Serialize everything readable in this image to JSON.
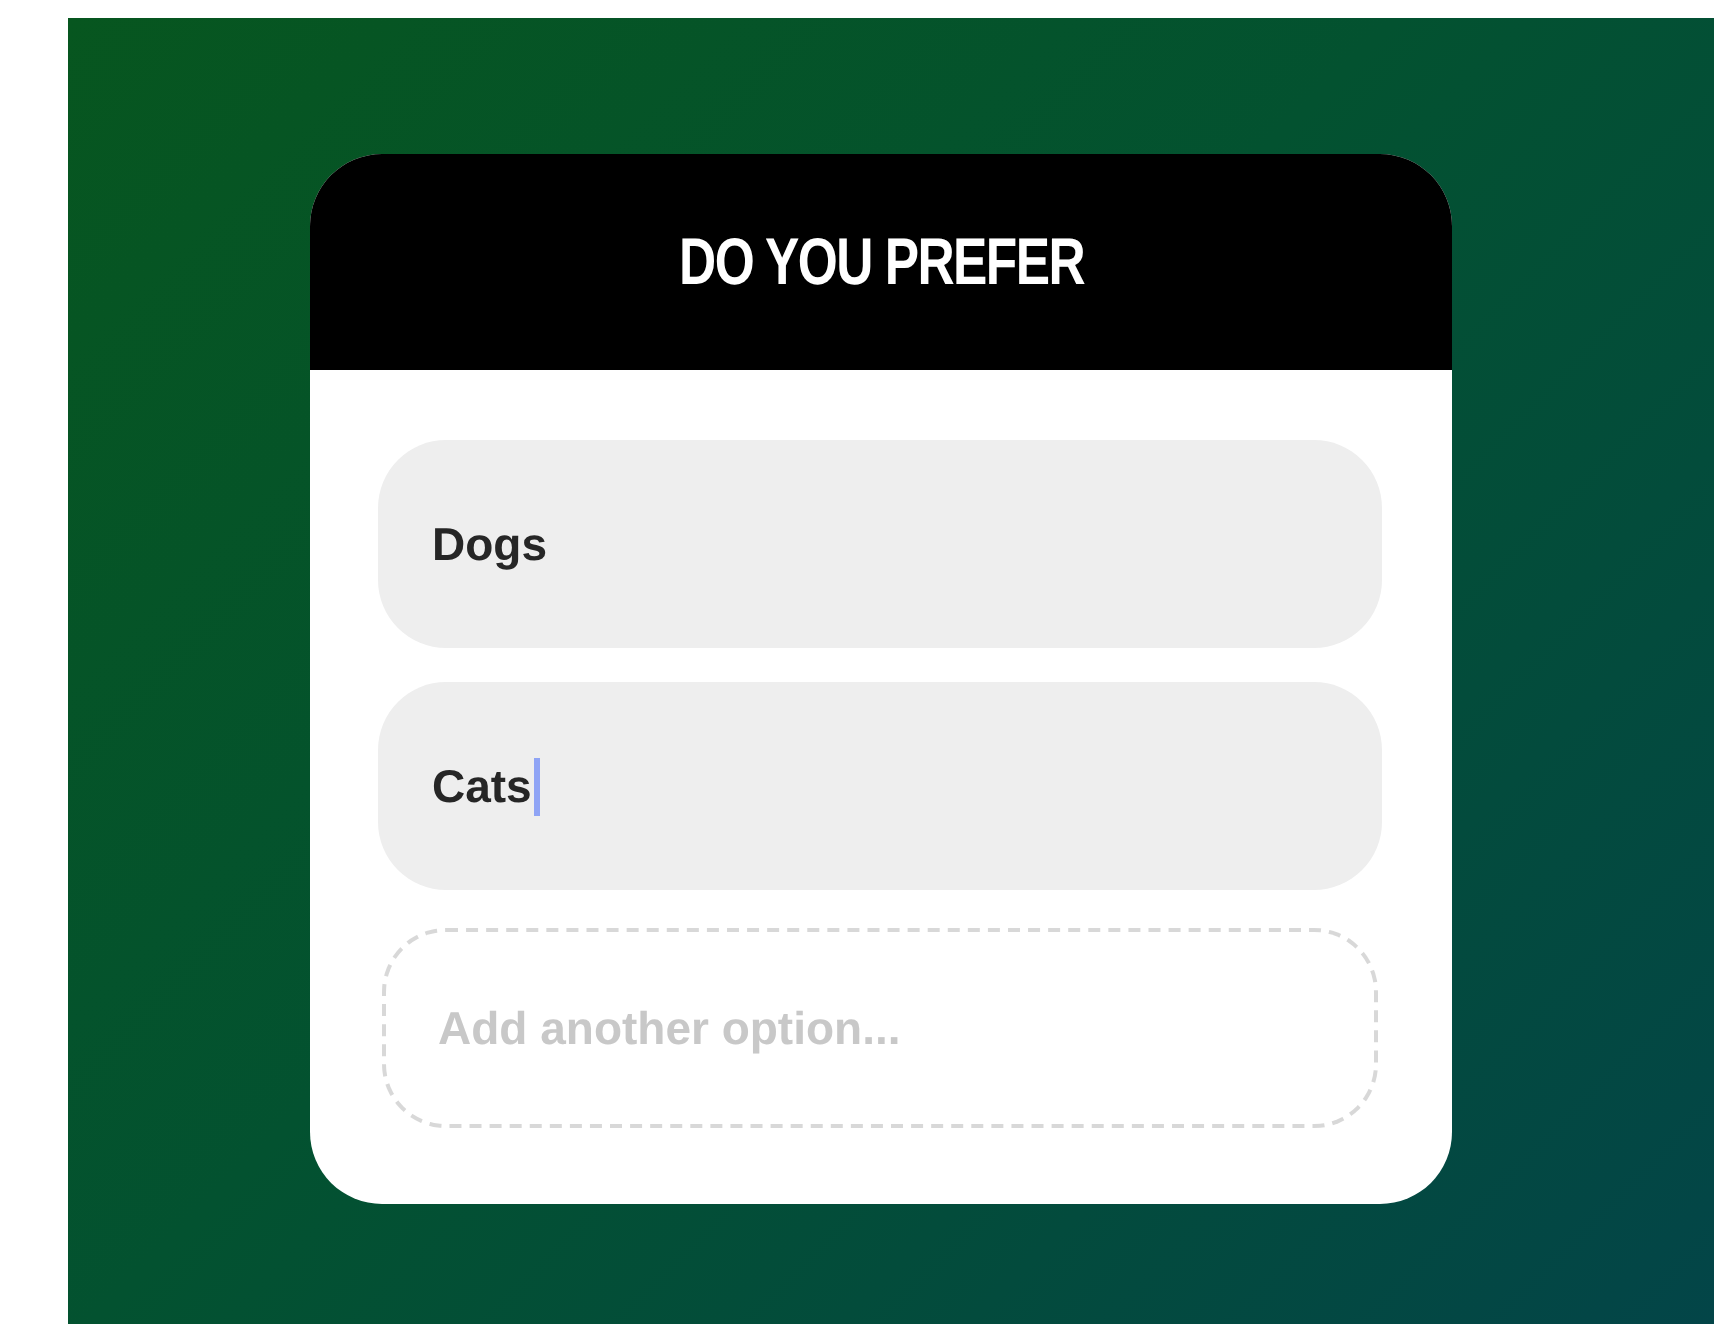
{
  "title": "DO YOU PREFER",
  "options": [
    {
      "value": "Dogs",
      "focused": false
    },
    {
      "value": "Cats",
      "focused": true
    }
  ],
  "add_option": {
    "placeholder": "Add another option..."
  }
}
